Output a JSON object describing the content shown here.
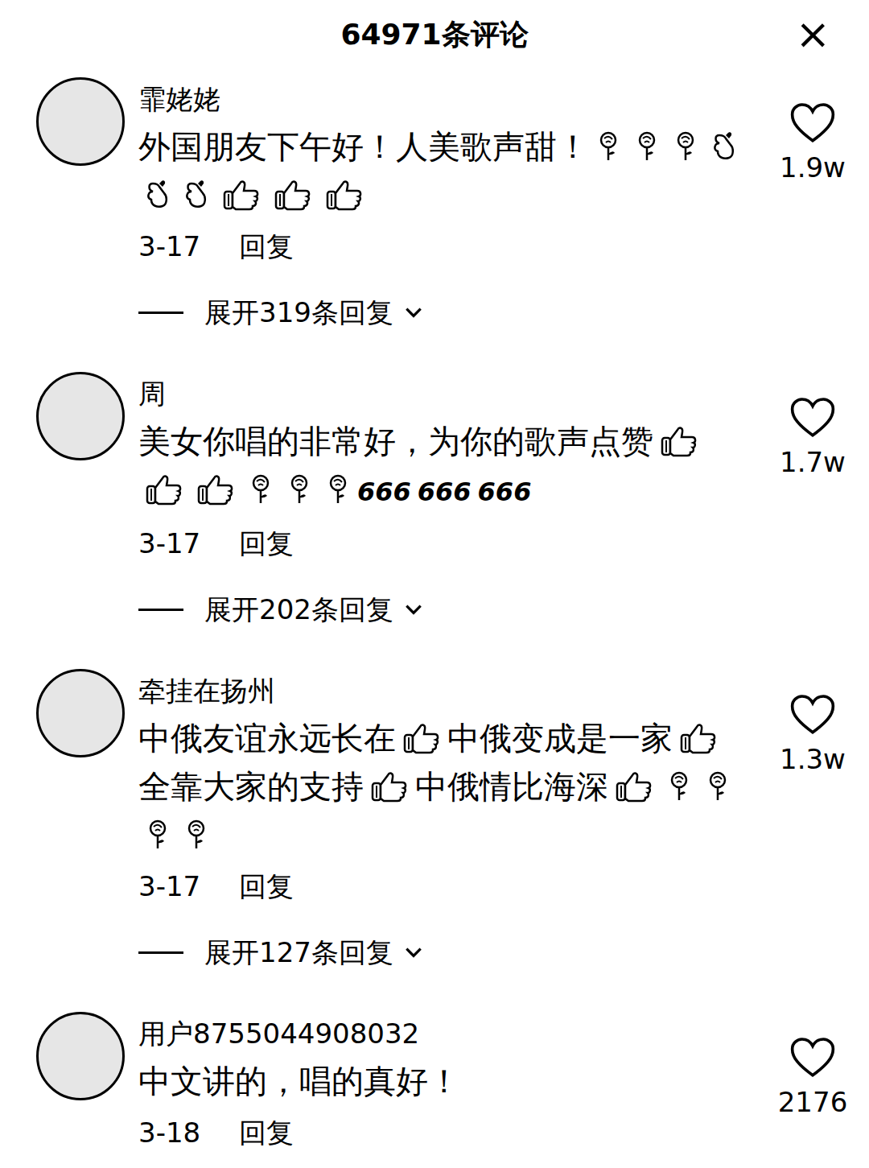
{
  "header": {
    "title": "64971条评论",
    "close": "×"
  },
  "comments": [
    {
      "user": "霏姥姥",
      "content": [
        {
          "kind": "text",
          "text": "外国朋友下午好！人美歌声甜！"
        },
        {
          "kind": "rose"
        },
        {
          "kind": "rose"
        },
        {
          "kind": "rose"
        },
        {
          "kind": "heart"
        },
        {
          "kind": "heart"
        },
        {
          "kind": "heart"
        },
        {
          "kind": "thumb"
        },
        {
          "kind": "thumb"
        },
        {
          "kind": "thumb"
        }
      ],
      "date": "3-17",
      "reply": "回复",
      "likes": "1.9w",
      "replies": "展开319条回复"
    },
    {
      "user": "周",
      "content": [
        {
          "kind": "text",
          "text": "美女你唱的非常好，为你的歌声点赞"
        },
        {
          "kind": "thumb"
        },
        {
          "kind": "thumb"
        },
        {
          "kind": "thumb"
        },
        {
          "kind": "rose"
        },
        {
          "kind": "rose"
        },
        {
          "kind": "rose"
        },
        {
          "kind": "sticker",
          "text": "666"
        },
        {
          "kind": "sticker",
          "text": "666"
        },
        {
          "kind": "sticker",
          "text": "666"
        }
      ],
      "date": "3-17",
      "reply": "回复",
      "likes": "1.7w",
      "replies": "展开202条回复"
    },
    {
      "user": "牵挂在扬州",
      "content": [
        {
          "kind": "text",
          "text": "中俄友谊永远长在"
        },
        {
          "kind": "thumb"
        },
        {
          "kind": "text",
          "text": "中俄变成是一家"
        },
        {
          "kind": "thumb"
        },
        {
          "kind": "text",
          "text": "全靠大家的支持"
        },
        {
          "kind": "thumb"
        },
        {
          "kind": "text",
          "text": "中俄情比海深"
        },
        {
          "kind": "thumb"
        },
        {
          "kind": "rose"
        },
        {
          "kind": "rose"
        },
        {
          "kind": "rose"
        },
        {
          "kind": "rose"
        }
      ],
      "date": "3-17",
      "reply": "回复",
      "likes": "1.3w",
      "replies": "展开127条回复"
    },
    {
      "user": "用户8755044908032",
      "content": [
        {
          "kind": "text",
          "text": "中文讲的，唱的真好！"
        }
      ],
      "date": "3-18",
      "reply": "回复",
      "likes": "2176"
    }
  ]
}
